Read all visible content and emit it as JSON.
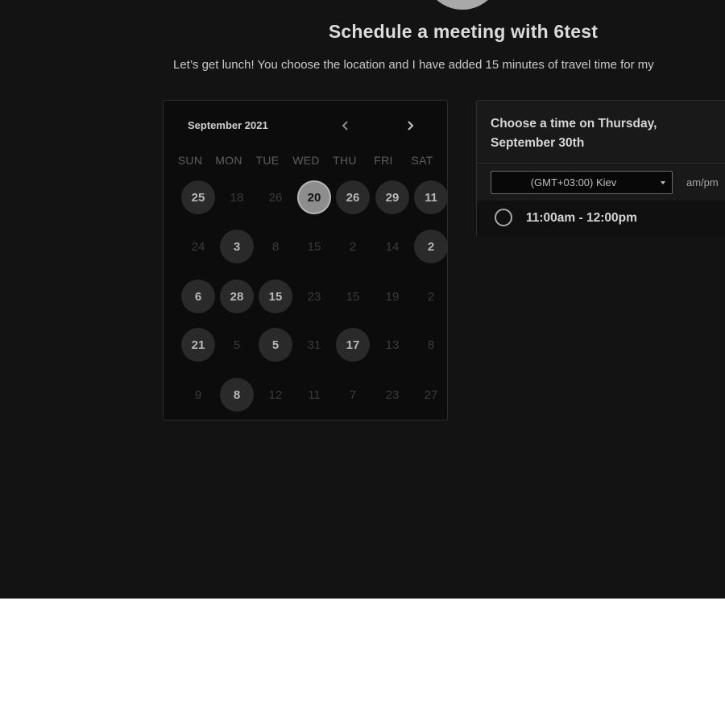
{
  "header": {
    "title": "Schedule a meeting with 6test",
    "description": "Let’s get lunch! You choose the location and I have added 15 minutes of travel time for my"
  },
  "calendar": {
    "month_label": "September 2021",
    "prev_icon": "chevron-left-icon",
    "next_icon": "chevron-right-icon",
    "weekdays": [
      "SUN",
      "MON",
      "TUE",
      "WED",
      "THU",
      "FRI",
      "SAT"
    ],
    "weeks": [
      [
        {
          "d": "25",
          "s": "avail"
        },
        {
          "d": "18",
          "s": "muted"
        },
        {
          "d": "26",
          "s": "muted"
        },
        {
          "d": "20",
          "s": "selected"
        },
        {
          "d": "26",
          "s": "avail"
        },
        {
          "d": "29",
          "s": "avail"
        },
        {
          "d": "11",
          "s": "avail"
        }
      ],
      [
        {
          "d": "24",
          "s": "muted"
        },
        {
          "d": "3",
          "s": "avail"
        },
        {
          "d": "8",
          "s": "muted"
        },
        {
          "d": "15",
          "s": "muted"
        },
        {
          "d": "2",
          "s": "muted"
        },
        {
          "d": "14",
          "s": "muted"
        },
        {
          "d": "2",
          "s": "avail"
        }
      ],
      [
        {
          "d": "6",
          "s": "avail"
        },
        {
          "d": "28",
          "s": "avail"
        },
        {
          "d": "15",
          "s": "avail"
        },
        {
          "d": "23",
          "s": "muted"
        },
        {
          "d": "15",
          "s": "muted"
        },
        {
          "d": "19",
          "s": "muted"
        },
        {
          "d": "2",
          "s": "muted"
        }
      ],
      [
        {
          "d": "21",
          "s": "avail"
        },
        {
          "d": "5",
          "s": "muted"
        },
        {
          "d": "5",
          "s": "avail"
        },
        {
          "d": "31",
          "s": "muted"
        },
        {
          "d": "17",
          "s": "avail"
        },
        {
          "d": "13",
          "s": "muted"
        },
        {
          "d": "8",
          "s": "muted"
        }
      ],
      [
        {
          "d": "9",
          "s": "muted"
        },
        {
          "d": "8",
          "s": "avail"
        },
        {
          "d": "12",
          "s": "muted"
        },
        {
          "d": "11",
          "s": "muted"
        },
        {
          "d": "7",
          "s": "muted"
        },
        {
          "d": "23",
          "s": "muted"
        },
        {
          "d": "27",
          "s": "muted"
        }
      ]
    ]
  },
  "time_panel": {
    "title": "Choose a time on Thursday, September 30th",
    "timezone_value": "(GMT+03:00) Kiev",
    "format_label": "am/pm",
    "slots": [
      {
        "label": "11:00am - 12:00pm"
      }
    ]
  },
  "colors": {
    "background": "#131313",
    "panel": "#191919",
    "available_day": "#2a2a2a",
    "selected_day": "#8d8d8d"
  }
}
